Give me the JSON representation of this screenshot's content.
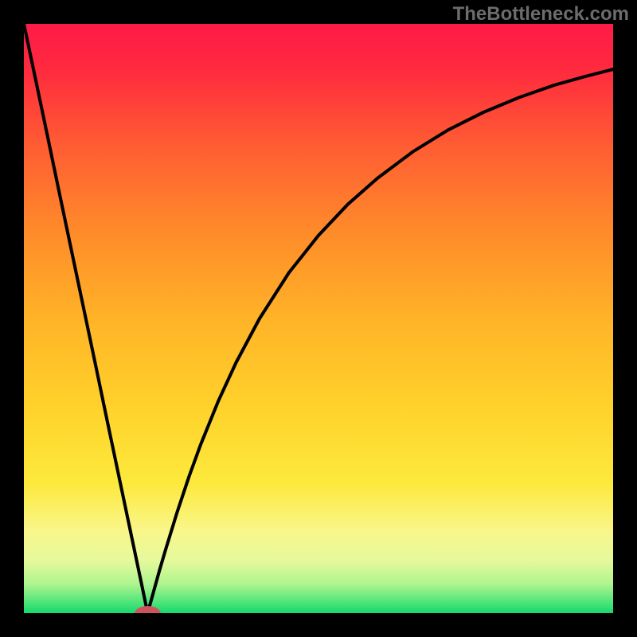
{
  "watermark": "TheBottleneck.com",
  "chart_data": {
    "type": "line",
    "title": "",
    "xlabel": "",
    "ylabel": "",
    "xlim": [
      0,
      100
    ],
    "ylim": [
      0,
      100
    ],
    "background_gradient": {
      "stops": [
        {
          "pos": 0.0,
          "color": "#ff1a47"
        },
        {
          "pos": 0.08,
          "color": "#ff2b3e"
        },
        {
          "pos": 0.2,
          "color": "#ff5a33"
        },
        {
          "pos": 0.35,
          "color": "#ff8a2a"
        },
        {
          "pos": 0.5,
          "color": "#ffb327"
        },
        {
          "pos": 0.65,
          "color": "#ffd22b"
        },
        {
          "pos": 0.78,
          "color": "#fde93c"
        },
        {
          "pos": 0.86,
          "color": "#f9f68a"
        },
        {
          "pos": 0.91,
          "color": "#e6f99b"
        },
        {
          "pos": 0.95,
          "color": "#b0f58f"
        },
        {
          "pos": 0.975,
          "color": "#63e87e"
        },
        {
          "pos": 1.0,
          "color": "#15d96e"
        }
      ]
    },
    "curve": {
      "minimum_x": 21,
      "description": "V-shaped bottleneck curve: near-linear steep descent from top-left to a minimum near x≈21 at y≈0, then a concave-down rise asymptotically approaching the top toward the right edge.",
      "x": [
        0,
        2,
        4,
        6,
        8,
        10,
        12,
        14,
        16,
        18,
        20,
        20.5,
        21,
        21.5,
        22,
        23,
        24,
        26,
        28,
        30,
        33,
        36,
        40,
        45,
        50,
        55,
        60,
        66,
        72,
        78,
        84,
        90,
        95,
        100
      ],
      "y": [
        100,
        90.5,
        81,
        71.4,
        61.9,
        52.4,
        42.9,
        33.3,
        23.8,
        14.3,
        4.8,
        2.4,
        0,
        1.8,
        3.6,
        7.2,
        10.6,
        17.1,
        23.1,
        28.6,
        36.0,
        42.5,
        50.0,
        57.8,
        64.1,
        69.4,
        73.8,
        78.3,
        82.0,
        85.0,
        87.5,
        89.6,
        91.0,
        92.3
      ]
    },
    "marker": {
      "x": 21,
      "y": 0,
      "rx": 2.2,
      "ry": 1.2,
      "color": "#d1525f"
    }
  }
}
